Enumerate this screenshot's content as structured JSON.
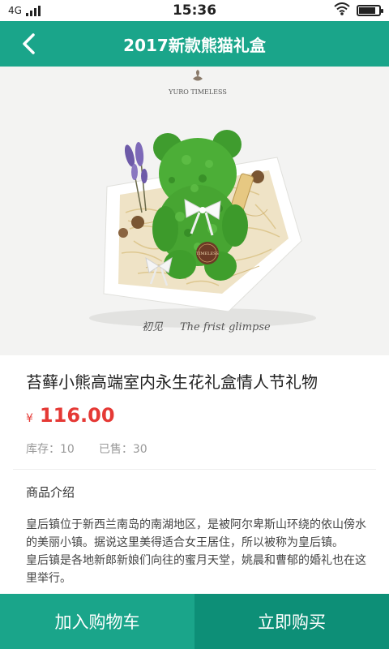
{
  "status_bar": {
    "network": "4G",
    "time": "15:36",
    "battery_level": 0.85
  },
  "header": {
    "title": "2017新款熊猫礼盒"
  },
  "product_image": {
    "brand_text": "YURO TIMELESS",
    "caption_cn": "初见",
    "caption_en": "The frist glimpse",
    "tag_text": "TIMELESS"
  },
  "product": {
    "name": "苔藓小熊高端室内永生花礼盒情人节礼物",
    "price_symbol": "¥",
    "price": "116.00",
    "stock": "库存：10",
    "sold": "已售：30"
  },
  "description": {
    "title": "商品介绍",
    "paragraphs": [
      "皇后镇位于新西兰南岛的南湖地区，是被阿尔卑斯山环绕的依山傍水的美丽小镇。据说这里美得适合女王居住，所以被称为皇后镇。",
      "皇后镇是各地新郎新娘们向往的蜜月天堂，姚晨和曹郁的婚礼也在这里举行。"
    ]
  },
  "bottom_bar": {
    "add_to_cart": "加入购物车",
    "buy_now": "立即购买"
  },
  "colors": {
    "brand_green": "#1aa58a",
    "dark_green": "#0d8f77",
    "price_red": "#e53935"
  }
}
